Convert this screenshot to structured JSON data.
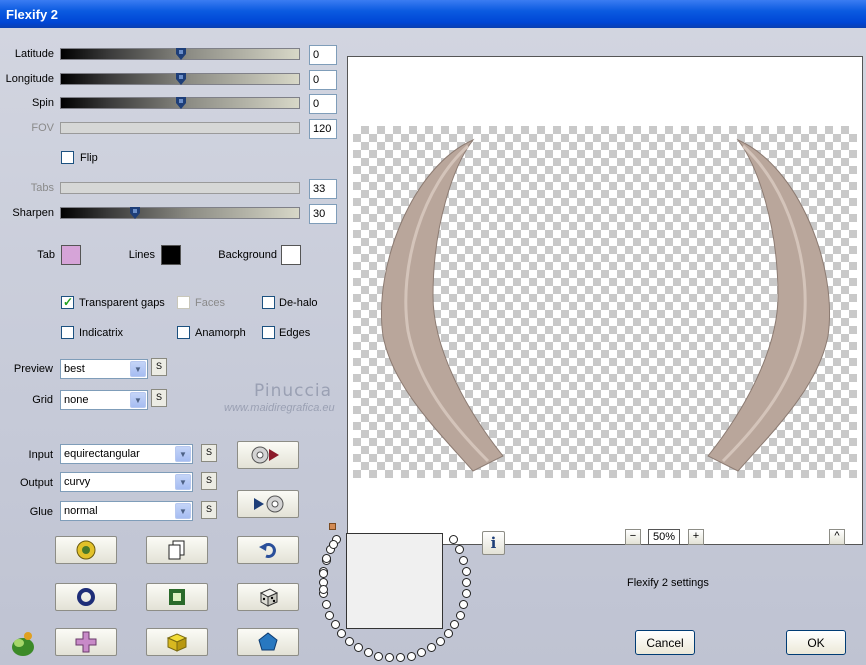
{
  "window": {
    "title": "Flexify 2"
  },
  "sliders": [
    {
      "label": "Latitude",
      "value": "0",
      "level": 0.5,
      "disabled": false
    },
    {
      "label": "Longitude",
      "value": "0",
      "level": 0.5,
      "disabled": false
    },
    {
      "label": "Spin",
      "value": "0",
      "level": 0.5,
      "disabled": false
    },
    {
      "label": "FOV",
      "value": "120",
      "disabled": true
    },
    {
      "label": "Tabs",
      "value": "33",
      "disabled": true
    },
    {
      "label": "Sharpen",
      "value": "30",
      "level": 0.3,
      "disabled": false
    }
  ],
  "flip": {
    "label": "Flip",
    "checked": false
  },
  "colors": {
    "tab_label": "Tab",
    "tab_color": "#d6a4d8",
    "lines_label": "Lines",
    "lines_color": "#000000",
    "background_label": "Background",
    "background_color": "#ffffff"
  },
  "options": {
    "transparent_gaps": {
      "label": "Transparent gaps",
      "checked": true
    },
    "faces": {
      "label": "Faces",
      "checked": false,
      "disabled": true
    },
    "dehalo": {
      "label": "De-halo",
      "checked": false
    },
    "indicatrix": {
      "label": "Indicatrix",
      "checked": false
    },
    "anamorph": {
      "label": "Anamorph",
      "checked": false
    },
    "edges": {
      "label": "Edges",
      "checked": false
    }
  },
  "preview_select": {
    "label": "Preview",
    "value": "best"
  },
  "grid_select": {
    "label": "Grid",
    "value": "none"
  },
  "watermark": {
    "name": "Pinuccia",
    "site": "www.maidiregrafica.eu"
  },
  "input_select": {
    "label": "Input",
    "value": "equirectangular"
  },
  "output_select": {
    "label": "Output",
    "value": "curvy"
  },
  "glue_select": {
    "label": "Glue",
    "value": "normal"
  },
  "s_label": "S",
  "zoom": {
    "minus": "−",
    "value": "50%",
    "plus": "+"
  },
  "scroll_up": "^",
  "info_label": "i",
  "settings_text": "Flexify 2 settings",
  "buttons": {
    "cancel": "Cancel",
    "ok": "OK"
  },
  "preview_colors": {
    "horn": "#b9a69b",
    "horn_dark": "#8c7b72"
  }
}
